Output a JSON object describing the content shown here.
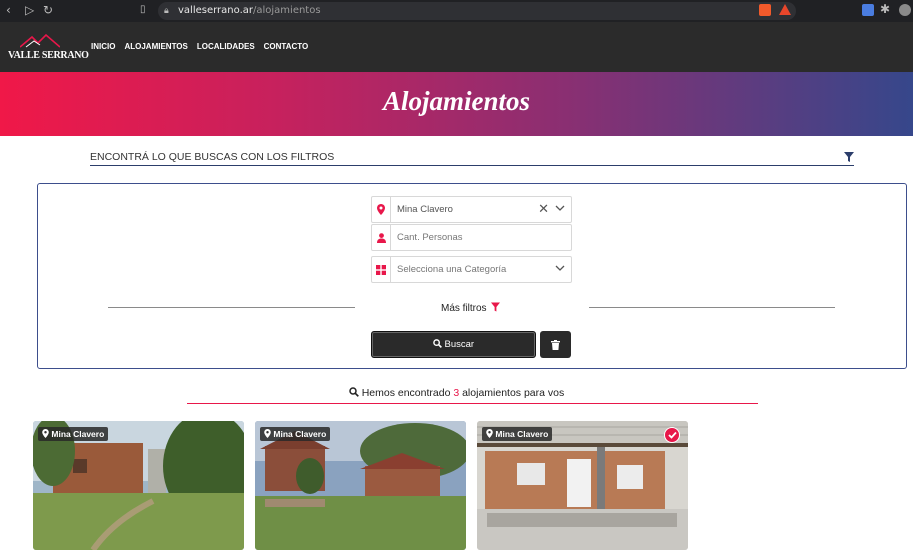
{
  "browser": {
    "url_domain": "valleserrano.ar",
    "url_path": "/alojamientos"
  },
  "site": {
    "logo_text": "VALLE SERRANO",
    "menu": [
      {
        "label": "INICIO"
      },
      {
        "label": "ALOJAMIENTOS"
      },
      {
        "label": "LOCALIDADES"
      },
      {
        "label": "CONTACTO"
      }
    ]
  },
  "hero": {
    "title": "Alojamientos"
  },
  "filters": {
    "toggle_label": "ENCONTRÁ LO QUE BUSCAS CON LOS FILTROS",
    "location_value": "Mina Clavero",
    "guests_placeholder": "Cant. Personas",
    "category_placeholder": "Selecciona una Categoría",
    "more_filters_label": "Más filtros",
    "search_button_label": "Buscar"
  },
  "results": {
    "prefix": "Hemos encontrado",
    "count": "3",
    "suffix": "alojamientos para vos"
  },
  "cards": [
    {
      "location": "Mina Clavero",
      "checked": false
    },
    {
      "location": "Mina Clavero",
      "checked": false
    },
    {
      "location": "Mina Clavero",
      "checked": true
    }
  ],
  "colors": {
    "accent": "#e8174a",
    "navy": "#2c3e6b",
    "header_bg": "#2b2b2b",
    "hero_gradient": [
      "#f01848",
      "#36478b"
    ]
  }
}
